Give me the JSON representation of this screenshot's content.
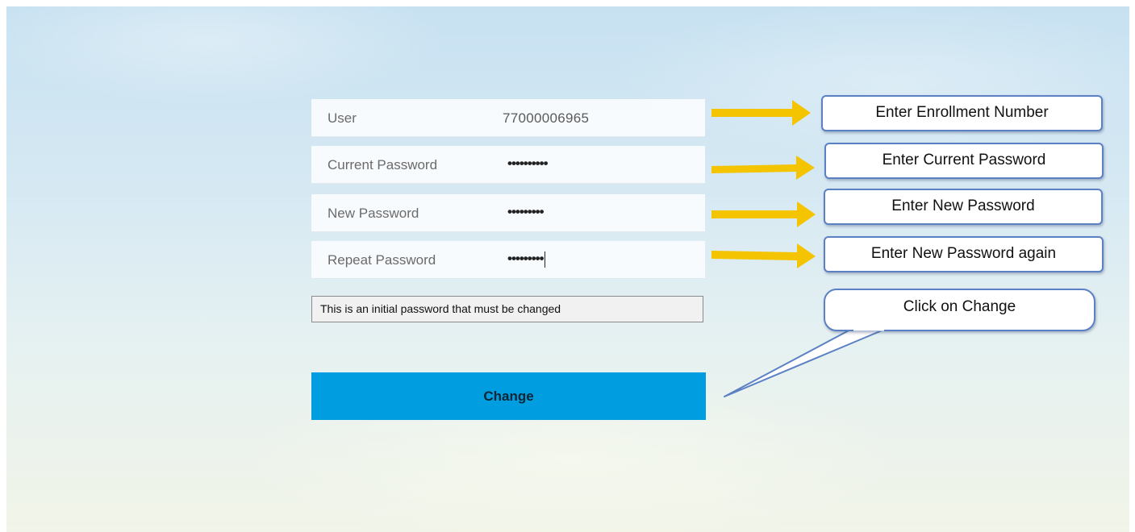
{
  "form": {
    "user": {
      "label": "User",
      "value": "77000006965"
    },
    "current_password": {
      "label": "Current Password",
      "masked": "••••••••••"
    },
    "new_password": {
      "label": "New Password",
      "masked": "•••••••••"
    },
    "repeat_password": {
      "label": "Repeat Password",
      "masked": "•••••••••"
    },
    "notice": "This is an initial password that must be changed",
    "change_label": "Change"
  },
  "annotations": {
    "enrollment": "Enter Enrollment Number",
    "current": "Enter Current Password",
    "new": "Enter New Password",
    "again": "Enter New Password again",
    "change": "Click on Change"
  },
  "colors": {
    "accent_button": "#009ee0",
    "arrow": "#f5c400",
    "callout_border": "#5b80c4"
  }
}
